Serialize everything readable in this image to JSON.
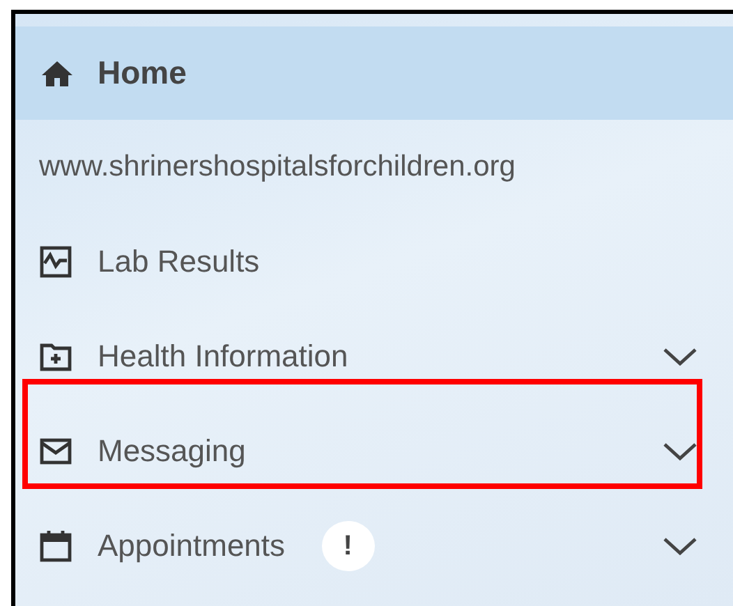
{
  "home": {
    "label": "Home",
    "selected": true
  },
  "items": [
    {
      "kind": "link",
      "label": "www.shrinershospitalsforchildren.org",
      "expandable": false,
      "highlighted": false
    },
    {
      "kind": "nav",
      "label": "Lab Results",
      "expandable": false,
      "highlighted": false
    },
    {
      "kind": "nav",
      "label": "Health Information",
      "expandable": true,
      "highlighted": false
    },
    {
      "kind": "nav",
      "label": "Messaging",
      "expandable": true,
      "highlighted": true
    },
    {
      "kind": "nav",
      "label": "Appointments",
      "expandable": true,
      "highlighted": false,
      "badge": "!"
    }
  ]
}
